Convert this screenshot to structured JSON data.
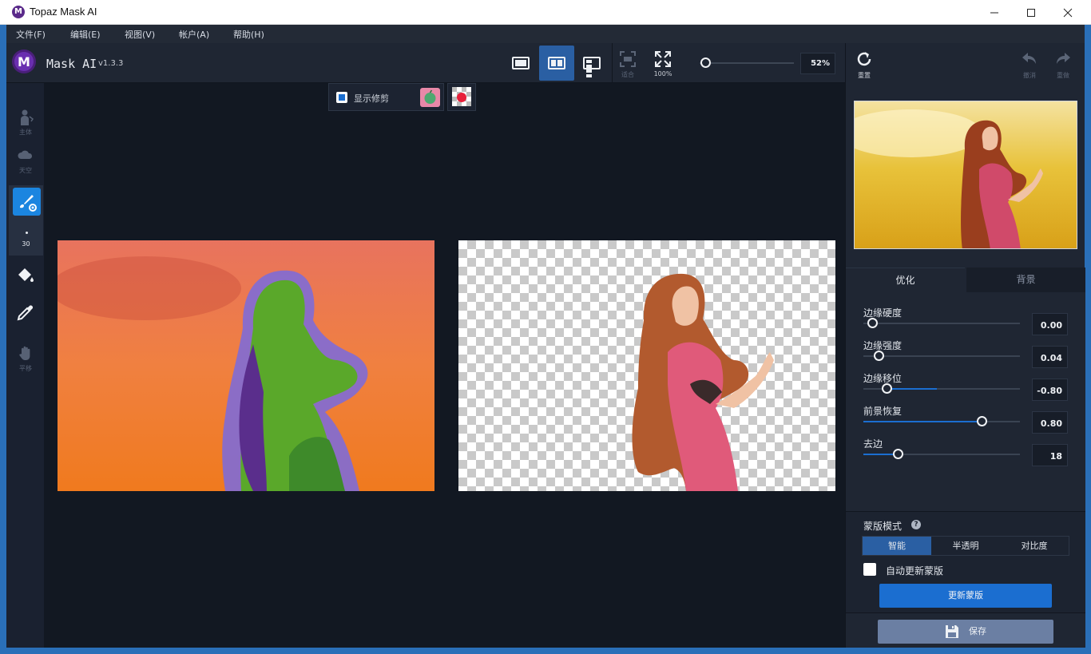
{
  "window": {
    "title": "Topaz Mask AI"
  },
  "menu": [
    "文件(F)",
    "编辑(E)",
    "视图(V)",
    "帐户(A)",
    "帮助(H)"
  ],
  "toolbar": {
    "app_name": "Mask AI",
    "version": "v1.3.3",
    "fit_label": "适合",
    "zoom100_label": "100%",
    "zoom_value": "52%",
    "zoom_level_fraction": 0.06
  },
  "right_toolbar": {
    "reset_label": "重置",
    "undo_label": "撤消",
    "redo_label": "重做"
  },
  "left_tools": {
    "subject_label": "主体",
    "sky_label": "天空",
    "brush_size": "30",
    "pan_label": "平移"
  },
  "canvas": {
    "show_trim_label": "显示修剪",
    "show_trim_checked": true
  },
  "panel": {
    "tabs": [
      {
        "label": "优化",
        "active": true
      },
      {
        "label": "背景",
        "active": false
      }
    ],
    "sliders": [
      {
        "label": "边缘硬度",
        "value": "0.00",
        "position": 0.06,
        "fill_from": null
      },
      {
        "label": "边缘强度",
        "value": "0.04",
        "position": 0.1,
        "fill_from": null
      },
      {
        "label": "边缘移位",
        "value": "-0.80",
        "position": 0.15,
        "fill_from": 0.47
      },
      {
        "label": "前景恢复",
        "value": "0.80",
        "position": 0.76,
        "fill_from": 0
      },
      {
        "label": "去边",
        "value": "18",
        "position": 0.22,
        "fill_from": 0
      }
    ],
    "mask_mode": {
      "title": "蒙版模式",
      "options": [
        "智能",
        "半透明",
        "对比度"
      ],
      "selected": "智能"
    },
    "auto_update_label": "自动更新蒙版",
    "update_button_label": "更新蒙版",
    "save_button_label": "保存"
  },
  "colors": {
    "accent": "#1b6ed0",
    "active_view": "#2a5fa3",
    "panel_bg": "#1f2633",
    "canvas_bg": "#121822",
    "save_bg": "#6b7fa3"
  }
}
